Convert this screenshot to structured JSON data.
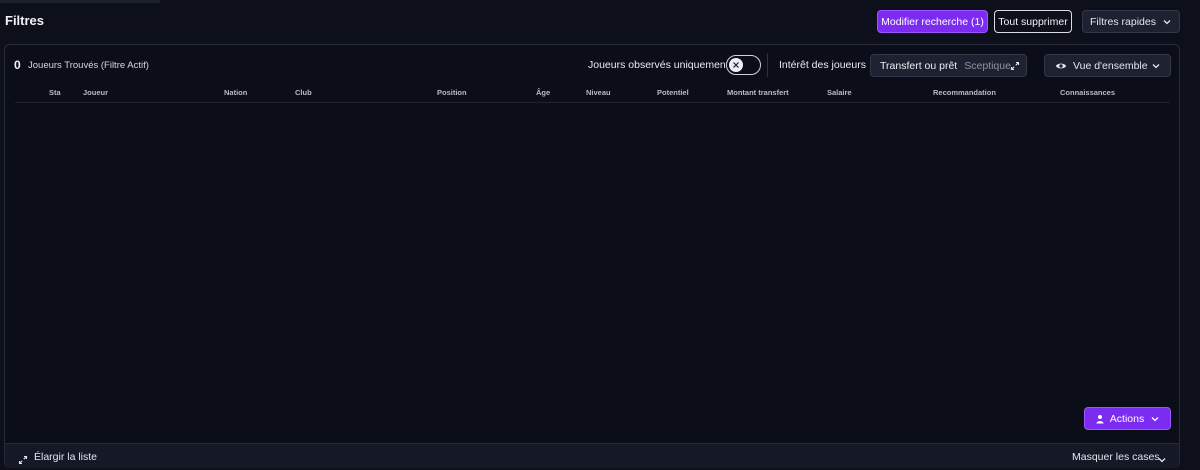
{
  "header": {
    "title": "Filtres",
    "modify_search": "Modifier recherche (1)",
    "delete_all": "Tout supprimer",
    "quick_filters": "Filtres rapides"
  },
  "results": {
    "count": "0",
    "label": "Joueurs Trouvés (Filtre Actif)"
  },
  "controls": {
    "observed_only_label": "Joueurs observés uniquement",
    "observed_only_on": false,
    "interest_label": "Intérêt des joueurs",
    "interest_value": "Transfert ou prêt",
    "interest_sub": "Sceptique",
    "view_label": "Vue d'ensemble"
  },
  "table": {
    "columns": [
      "Sta",
      "Joueur",
      "Nation",
      "Club",
      "Position",
      "Âge",
      "Niveau",
      "Potentiel",
      "Montant transfert",
      "Salaire",
      "Recommandation",
      "Connaissances"
    ],
    "rows": []
  },
  "actions": {
    "label": "Actions"
  },
  "footer": {
    "expand_label": "Élargir la liste",
    "hide_boxes_label": "Masquer les cases"
  },
  "colors": {
    "accent": "#7b2cf0",
    "background": "#0d101a",
    "panel": "#0b0e18"
  }
}
